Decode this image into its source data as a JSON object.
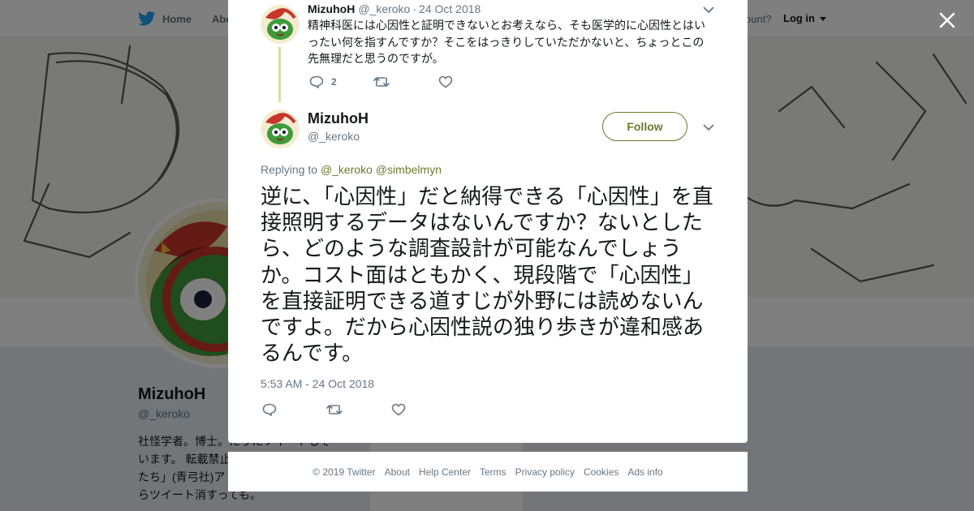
{
  "background": {
    "nav": {
      "home_label": "Home",
      "about_label": "Abo",
      "account_prompt": "ccount?",
      "login_label": "Log in"
    },
    "profile": {
      "name": "MizuhoH",
      "handle": "@_keroko",
      "bio_lines": [
        "社怪学者。博士。たりたソイートしそ",
        "います。 転載禁止",
        "たち」(青弓社)ア",
        "らツイート消すっても。"
      ]
    }
  },
  "modal": {
    "parent_tweet": {
      "name": "MizuhoH",
      "handle": "@_keroko",
      "separator": "·",
      "date": "24 Oct 2018",
      "text": "精神科医には心因性と証明できないとお考えなら、そも医学的に心因性とはいったい何を指すんですか？そこをはっきりしていただかないと、ちょっとこの先無理だと思うのですが。",
      "reply_count": "2"
    },
    "main_tweet": {
      "name": "MizuhoH",
      "handle": "@_keroko",
      "follow_label": "Follow",
      "replying_prefix": "Replying to",
      "mention_1": "@_keroko",
      "mention_2": "@simbelmyn",
      "text": "逆に、「心因性」だと納得できる「心因性」を直接照明するデータはないんですか？ないとしたら、どのような調査設計が可能なんでしょうか。コスト面はともかく、現段階で「心因性」を直接証明できる道すじが外野には読めないんですよ。だから心因性説の独り歩きが違和感あるんです。",
      "timestamp": "5:53 AM - 24 Oct 2018"
    }
  },
  "footer": {
    "copyright": "© 2019 Twitter",
    "about": "About",
    "help": "Help Center",
    "terms": "Terms",
    "privacy": "Privacy policy",
    "cookies": "Cookies",
    "ads": "Ads info"
  },
  "colors": {
    "accent": "#6d7a2d",
    "twitter_blue": "#1da1f2",
    "overlay": "rgba(0,0,0,0.5)"
  },
  "icons": [
    "twitter-bird-icon",
    "close-icon",
    "reply-icon",
    "retweet-icon",
    "like-icon",
    "chevron-down-icon",
    "avatar-keroro-icon"
  ]
}
